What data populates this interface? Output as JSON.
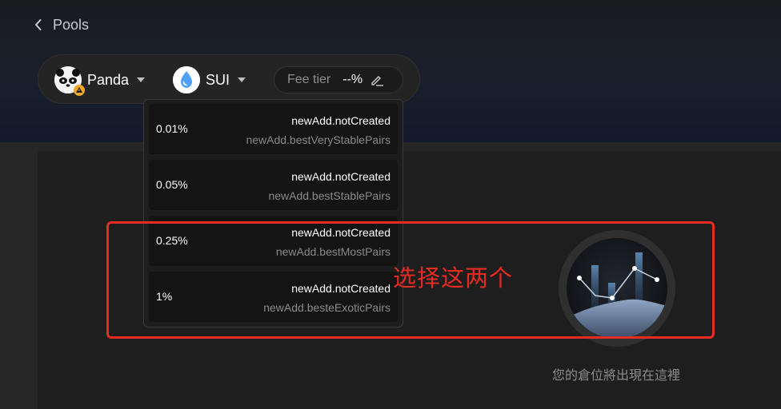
{
  "header": {
    "back_label": "Pools",
    "back_icon": "chevron-left-icon"
  },
  "selector": {
    "token_a": {
      "label": "Panda",
      "icon": "panda-icon",
      "badge_icon": "warning-badge-icon"
    },
    "token_b": {
      "label": "SUI",
      "icon": "sui-droplet-icon"
    },
    "fee": {
      "label": "Fee tier",
      "value": "--%",
      "icon": "edit-pencil-icon"
    }
  },
  "fee_options": [
    {
      "pct": "0.01%",
      "status": "newAdd.notCreated",
      "desc": "newAdd.bestVeryStablePairs"
    },
    {
      "pct": "0.05%",
      "status": "newAdd.notCreated",
      "desc": "newAdd.bestStablePairs"
    },
    {
      "pct": "0.25%",
      "status": "newAdd.notCreated",
      "desc": "newAdd.bestMostPairs"
    },
    {
      "pct": "1%",
      "status": "newAdd.notCreated",
      "desc": "newAdd.besteExoticPairs"
    }
  ],
  "annotation": {
    "text": "选择这两个",
    "color": "#e52b22"
  },
  "empty_state": {
    "illustration_icon": "chart-illustration-icon",
    "message": "您的倉位將出現在這裡"
  },
  "colors": {
    "background": "#262626",
    "header_gradient_end": "#141a2c",
    "accent_sui": "#4da2ff"
  }
}
